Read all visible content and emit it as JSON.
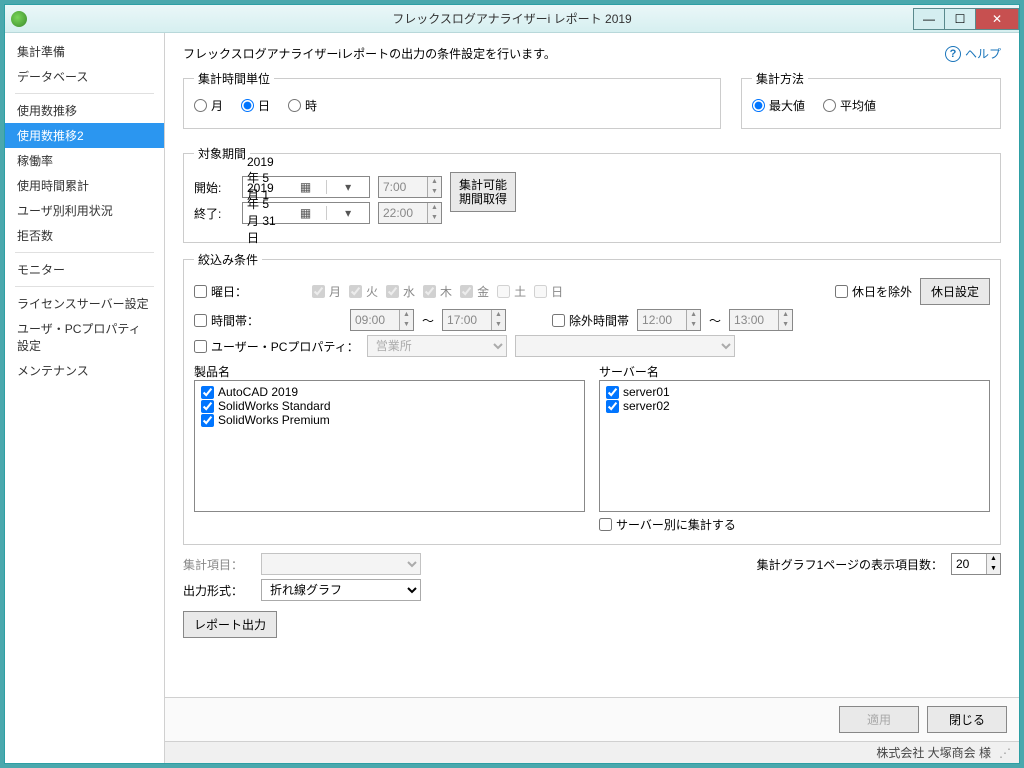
{
  "window": {
    "title": "フレックスログアナライザーi レポート 2019"
  },
  "sidebar": {
    "groups": [
      {
        "items": [
          "集計準備",
          "データベース"
        ]
      },
      {
        "items": [
          "使用数推移",
          "使用数推移2",
          "稼働率",
          "使用時間累計",
          "ユーザ別利用状況",
          "拒否数"
        ],
        "selected": 1
      },
      {
        "items": [
          "モニター"
        ]
      },
      {
        "items": [
          "ライセンスサーバー設定",
          "ユーザ・PCプロパティ設定",
          "メンテナンス"
        ]
      }
    ]
  },
  "intro": "フレックスログアナライザーiレポートの出力の条件設定を行います。",
  "help": "ヘルプ",
  "unit": {
    "legend": "集計時間単位",
    "options": [
      "月",
      "日",
      "時"
    ],
    "selected": 1
  },
  "method": {
    "legend": "集計方法",
    "options": [
      "最大値",
      "平均値"
    ],
    "selected": 0
  },
  "period": {
    "legend": "対象期間",
    "start_label": "開始:",
    "end_label": "終了:",
    "start_date": "2019年  5月  1日",
    "end_date": "2019年  5月 31日",
    "start_time": "7:00",
    "end_time": "22:00",
    "fetch_button": "集計可能\n期間取得"
  },
  "filter": {
    "legend": "絞込み条件",
    "weekday_label": "曜日：",
    "weekdays": [
      "月",
      "火",
      "水",
      "木",
      "金",
      "土",
      "日"
    ],
    "weekday_checked": [
      true,
      true,
      true,
      true,
      true,
      false,
      false
    ],
    "exclude_holiday": "休日を除外",
    "holiday_btn": "休日設定",
    "timeband_label": "時間帯：",
    "time_from": "09:00",
    "time_to": "17:00",
    "time_sep": "～",
    "exclude_time_label": "除外時間帯",
    "ex_time_from": "12:00",
    "ex_time_to": "13:00",
    "userprop_label": "ユーザー・PCプロパティ：",
    "userprop_value": "営業所",
    "product_label": "製品名",
    "products": [
      "AutoCAD 2019",
      "SolidWorks Standard",
      "SolidWorks Premium"
    ],
    "server_label": "サーバー名",
    "servers": [
      "server01",
      "server02"
    ],
    "per_server": "サーバー別に集計する"
  },
  "bottom": {
    "agg_item_label": "集計項目：",
    "output_fmt_label": "出力形式：",
    "output_fmt_value": "折れ線グラフ",
    "items_per_page_label": "集計グラフ1ページの表示項目数：",
    "items_per_page": "20",
    "report_btn": "レポート出力"
  },
  "footer": {
    "apply": "適用",
    "close": "閉じる"
  },
  "status": "株式会社 大塚商会 様"
}
